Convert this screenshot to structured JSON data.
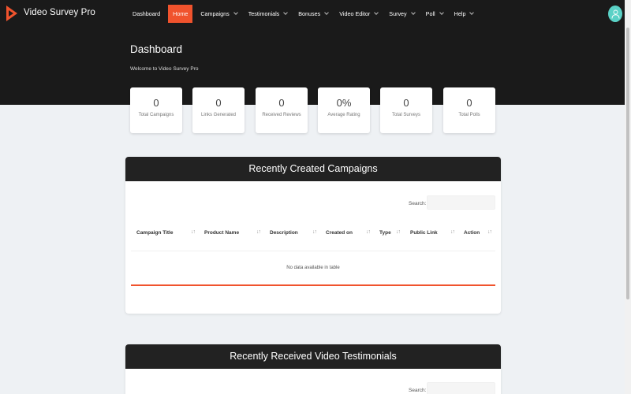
{
  "app": {
    "brand": "Video Survey Pro",
    "accent": "#f0532d"
  },
  "nav": {
    "items": [
      {
        "label": "Dashboard",
        "has_caret": false,
        "active": false
      },
      {
        "label": "Home",
        "has_caret": false,
        "active": true
      },
      {
        "label": "Campaigns",
        "has_caret": true,
        "active": false
      },
      {
        "label": "Testimonials",
        "has_caret": true,
        "active": false
      },
      {
        "label": "Bonuses",
        "has_caret": true,
        "active": false
      },
      {
        "label": "Video Editor",
        "has_caret": true,
        "active": false
      },
      {
        "label": "Survey",
        "has_caret": true,
        "active": false
      },
      {
        "label": "Poll",
        "has_caret": true,
        "active": false
      },
      {
        "label": "Help",
        "has_caret": true,
        "active": false
      }
    ]
  },
  "header": {
    "title": "Dashboard",
    "subtitle": "Welcome to Video Survey Pro"
  },
  "stats": [
    {
      "value": "0",
      "label": "Total Campaigns"
    },
    {
      "value": "0",
      "label": "Links Generated"
    },
    {
      "value": "0",
      "label": "Received Reviews"
    },
    {
      "value": "0%",
      "label": "Average Rating"
    },
    {
      "value": "0",
      "label": "Total Surveys"
    },
    {
      "value": "0",
      "label": "Total Polls"
    }
  ],
  "campaigns_panel": {
    "title": "Recently Created Campaigns",
    "search_label": "Search:",
    "columns": [
      "Campaign Title",
      "Product Name",
      "Description",
      "Created on",
      "Type",
      "Public Link",
      "Action"
    ],
    "empty_text": "No data available in table"
  },
  "testimonials_panel": {
    "title": "Recently Received Video Testimonials",
    "search_label": "Search:"
  }
}
